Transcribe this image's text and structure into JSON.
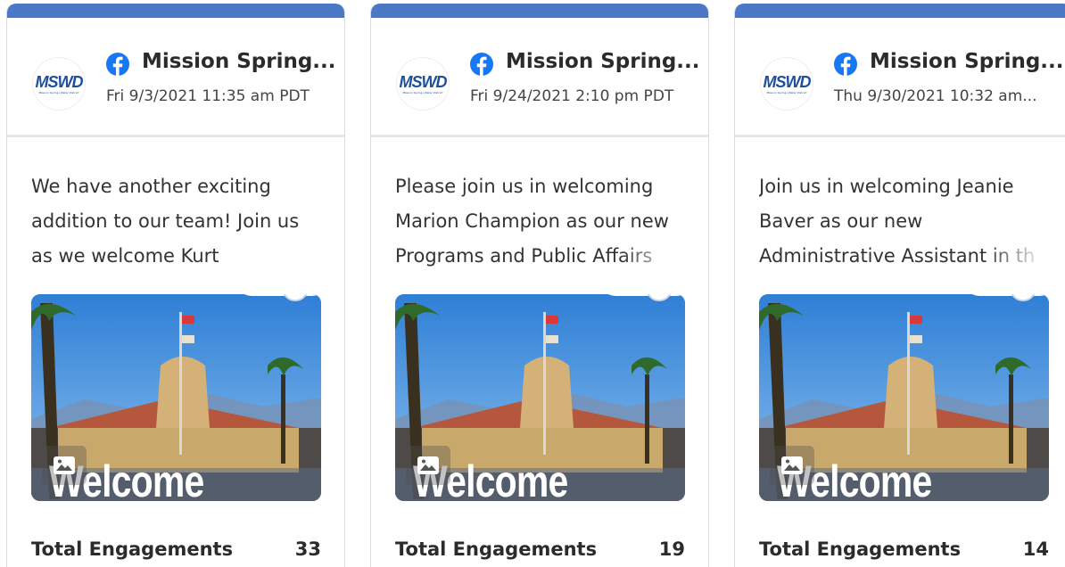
{
  "posts": [
    {
      "page_name": "Mission Spring...",
      "date": "Fri 9/3/2021 11:35 am PDT",
      "text": "We have another exciting addition to our team! Join us as we welcome Kurt",
      "image_caption": "Welcome",
      "metric_label": "Total Engagements",
      "metric_value": "33"
    },
    {
      "page_name": "Mission Spring...",
      "date": "Fri 9/24/2021 2:10 pm PDT",
      "text": "Please join us in welcoming Marion Champion as our new Programs and Public Affairs",
      "image_caption": "Welcome",
      "metric_label": "Total Engagements",
      "metric_value": "19"
    },
    {
      "page_name": "Mission Spring...",
      "date": "Thu 9/30/2021 10:32 am...",
      "text": "Join us in welcoming Jeanie Baver as our new Administrative Assistant in th",
      "image_caption": "Welcome",
      "metric_label": "Total Engagements",
      "metric_value": "14"
    }
  ],
  "avatar_logo": "MSWD",
  "avatar_subtitle": "Mission Springs Water District",
  "icons": {
    "network": "facebook-icon",
    "image_badge": "image-icon"
  },
  "colors": {
    "accent": "#4a78c4",
    "facebook": "#1877f2",
    "logo": "#1d4f9e"
  }
}
